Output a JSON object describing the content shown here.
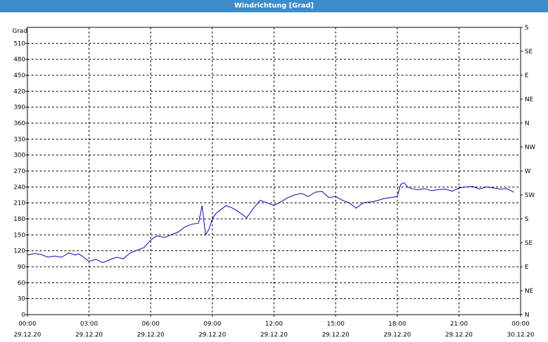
{
  "window": {
    "title": "Windrichtung [Grad]"
  },
  "chart_data": {
    "type": "line",
    "title": "Windrichtung [Grad]",
    "ylabel": "Grad",
    "xlim": [
      "29.12.20 00:00",
      "30.12.20 00:00"
    ],
    "ylim": [
      0,
      540
    ],
    "grid": true,
    "x_ticks": [
      {
        "time": "00:00",
        "date": "29.12.20",
        "hour": 0
      },
      {
        "time": "03:00",
        "date": "29.12.20",
        "hour": 3
      },
      {
        "time": "06:00",
        "date": "29.12.20",
        "hour": 6
      },
      {
        "time": "09:00",
        "date": "29.12.20",
        "hour": 9
      },
      {
        "time": "12:00",
        "date": "29.12.20",
        "hour": 12
      },
      {
        "time": "15:00",
        "date": "29.12.20",
        "hour": 15
      },
      {
        "time": "18:00",
        "date": "29.12.20",
        "hour": 18
      },
      {
        "time": "21:00",
        "date": "29.12.20",
        "hour": 21
      },
      {
        "time": "00:00",
        "date": "30.12.20",
        "hour": 24
      }
    ],
    "y_ticks": [
      0,
      30,
      60,
      90,
      120,
      150,
      180,
      210,
      240,
      270,
      300,
      330,
      360,
      390,
      420,
      450,
      480,
      510
    ],
    "right_ticks": [
      {
        "label": "N",
        "value": 0
      },
      {
        "label": "NE",
        "value": 45
      },
      {
        "label": "E",
        "value": 90
      },
      {
        "label": "SE",
        "value": 135
      },
      {
        "label": "S",
        "value": 180
      },
      {
        "label": "SW",
        "value": 225
      },
      {
        "label": "W",
        "value": 270
      },
      {
        "label": "NW",
        "value": 315
      },
      {
        "label": "N",
        "value": 360
      },
      {
        "label": "NE",
        "value": 405
      },
      {
        "label": "E",
        "value": 450
      },
      {
        "label": "SE",
        "value": 495
      },
      {
        "label": "S",
        "value": 540
      }
    ],
    "series": [
      {
        "color": "#0000aa",
        "x": [
          0,
          0.33,
          0.67,
          1,
          1.33,
          1.67,
          2,
          2.33,
          2.5,
          2.67,
          3,
          3.33,
          3.67,
          4,
          4.33,
          4.67,
          5,
          5.33,
          5.67,
          6,
          6.17,
          6.33,
          6.67,
          7,
          7.33,
          7.67,
          8,
          8.33,
          8.5,
          8.67,
          8.83,
          9,
          9.17,
          9.33,
          9.67,
          10,
          10.33,
          10.67,
          11,
          11.33,
          11.67,
          12,
          12.33,
          12.67,
          13,
          13.33,
          13.67,
          14,
          14.33,
          14.67,
          15,
          15.33,
          15.67,
          16,
          16.33,
          16.67,
          17,
          17.33,
          17.67,
          18,
          18.17,
          18.33,
          18.5,
          18.67,
          19,
          19.33,
          19.67,
          20,
          20.33,
          20.67,
          21,
          21.33,
          21.67,
          22,
          22.33,
          22.67,
          23,
          23.33,
          23.67
        ],
        "y": [
          112,
          115,
          113,
          108,
          110,
          108,
          116,
          112,
          114,
          110,
          100,
          104,
          98,
          103,
          108,
          105,
          116,
          121,
          126,
          140,
          145,
          148,
          145,
          150,
          155,
          165,
          170,
          172,
          205,
          150,
          160,
          180,
          190,
          195,
          205,
          200,
          192,
          182,
          200,
          215,
          210,
          205,
          212,
          220,
          225,
          228,
          222,
          230,
          232,
          220,
          222,
          215,
          210,
          200,
          210,
          212,
          214,
          218,
          220,
          222,
          245,
          248,
          240,
          237,
          235,
          237,
          233,
          235,
          236,
          232,
          238,
          240,
          241,
          236,
          240,
          238,
          236,
          237,
          230
        ]
      }
    ]
  }
}
